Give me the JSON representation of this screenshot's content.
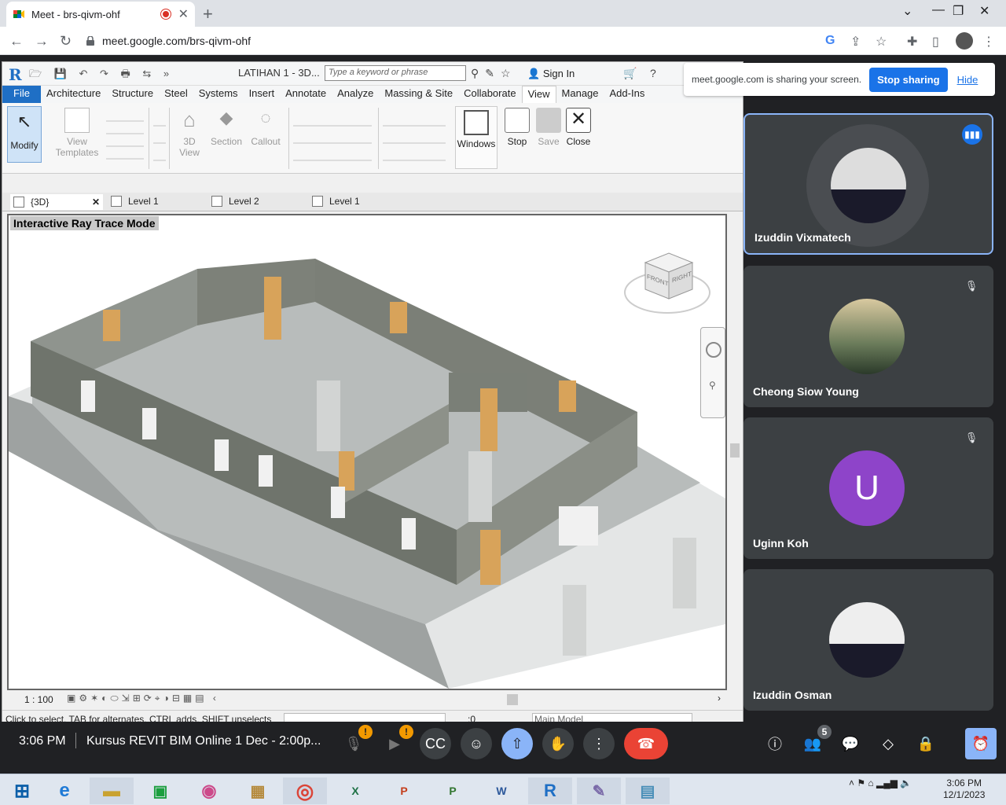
{
  "browser": {
    "tab_title": "Meet - brs-qivm-ohf",
    "url": "meet.google.com/brs-qivm-ohf"
  },
  "share_banner": {
    "message": "meet.google.com is sharing your screen.",
    "stop_label": "Stop sharing",
    "hide_label": "Hide"
  },
  "revit": {
    "doc_title": "LATIHAN 1 - 3D...",
    "search_placeholder": "Type a keyword or phrase",
    "sign_in": "Sign In",
    "menu": [
      "File",
      "Architecture",
      "Structure",
      "Steel",
      "Systems",
      "Insert",
      "Annotate",
      "Analyze",
      "Massing & Site",
      "Collaborate",
      "View",
      "Manage",
      "Add-Ins"
    ],
    "ribbon": {
      "modify": "Modify",
      "view_templates": "View Templates",
      "view_3d": "3D View",
      "section": "Section",
      "callout": "Callout",
      "windows": "Windows",
      "stop": "Stop",
      "save": "Save",
      "close": "Close"
    },
    "view_tabs": [
      "{3D}",
      "Level 1",
      "Level 2",
      "Level 1"
    ],
    "canvas_label": "Interactive Ray Trace Mode",
    "viewcube": {
      "front": "FRONT",
      "right": "RIGHT"
    },
    "scale": "1 : 100",
    "status_text": "Click to select, TAB for alternates, CTRL adds, SHIFT unselects",
    "selection_count": ":0",
    "model": "Main Model"
  },
  "participants": [
    {
      "name": "Izuddin Vixmatech",
      "speaking": true
    },
    {
      "name": "Cheong Siow Young",
      "muted": true
    },
    {
      "name": "Uginn Koh",
      "initial": "U",
      "muted": true
    },
    {
      "name": "Izuddin Osman"
    }
  ],
  "meeting": {
    "time": "3:06 PM",
    "title": "Kursus REVIT BIM Online 1 Dec - 2:00p...",
    "people_count": "5"
  },
  "taskbar": {
    "time": "3:06 PM",
    "date": "12/1/2023"
  }
}
